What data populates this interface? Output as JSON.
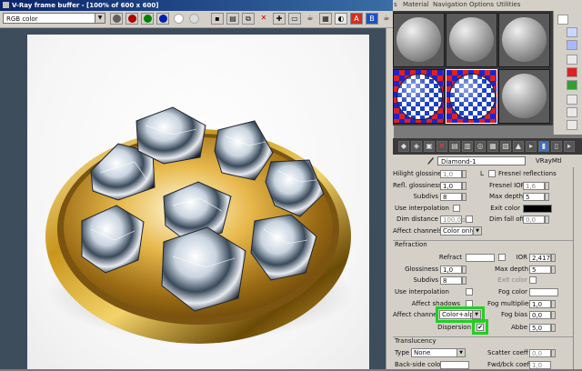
{
  "vfb": {
    "title": "V-Ray frame buffer - [100% of 600 x 600]",
    "channel_select": "RGB color",
    "toolbar_icons": [
      "red-channel-icon",
      "green-channel-icon",
      "blue-channel-icon",
      "alpha-icon",
      "mono-icon",
      "save-icon",
      "load-icon",
      "copy-icon",
      "clear-icon",
      "track-mouse-icon",
      "render-region-icon",
      "teapot-icon",
      "vfb-history-icon",
      "color-correction-icon",
      "lut-icon",
      "stamp-icon"
    ]
  },
  "material_editor": {
    "menu": [
      "s",
      "Material",
      "Navigation",
      "Options",
      "Utilities"
    ],
    "material_name": "Diamond-1",
    "material_type": "VRayMtl",
    "reflection": {
      "rows": [
        {
          "label": "Hilight glossiness",
          "value": "1,0"
        },
        {
          "label": "Refl. glossiness",
          "value": "1,0"
        },
        {
          "label": "Subdivs",
          "value": "8"
        },
        {
          "label": "Use interpolation",
          "value": ""
        },
        {
          "label": "Dim distance",
          "value": "100,0cr"
        },
        {
          "label": "Affect channels",
          "value": "Color only"
        }
      ],
      "right": [
        {
          "label": "L",
          "value": ""
        },
        {
          "label": "Fresnel reflections",
          "value": ""
        },
        {
          "label": "Fresnel IOR",
          "value": "1,6"
        },
        {
          "label": "Max depth",
          "value": "5"
        },
        {
          "label": "Exit color",
          "value": ""
        },
        {
          "label": "Dim fall off",
          "value": "0,0"
        }
      ]
    },
    "refraction": {
      "title": "Refraction",
      "left": [
        {
          "label": "Refract",
          "value": ""
        },
        {
          "label": "Glossiness",
          "value": "1,0"
        },
        {
          "label": "Subdivs",
          "value": "8"
        },
        {
          "label": "Use interpolation",
          "value": ""
        },
        {
          "label": "Affect shadows",
          "value": ""
        },
        {
          "label": "Affect channels",
          "value": "Color+alph"
        },
        {
          "label": "Dispersion",
          "value": "✔"
        }
      ],
      "right": [
        {
          "label": "IOR",
          "value": "2,417"
        },
        {
          "label": "Max depth",
          "value": "5"
        },
        {
          "label": "Exit color",
          "value": ""
        },
        {
          "label": "Fog color",
          "value": ""
        },
        {
          "label": "Fog multiplier",
          "value": "1,0"
        },
        {
          "label": "Fog bias",
          "value": "0,0"
        },
        {
          "label": "Abbe",
          "value": "5,0"
        }
      ]
    },
    "translucency": {
      "title": "Translucency",
      "type_label": "Type",
      "type_value": "None",
      "scatter_label": "Scatter coeff",
      "scatter_value": "0,0",
      "backside_label": "Back-side color",
      "fwd_label": "Fwd/bck coeff",
      "fwd_value": "1,0"
    }
  },
  "colors": {
    "highlight": "#22d022",
    "render_bg": "#ffffff",
    "exit_color": "#000000"
  }
}
